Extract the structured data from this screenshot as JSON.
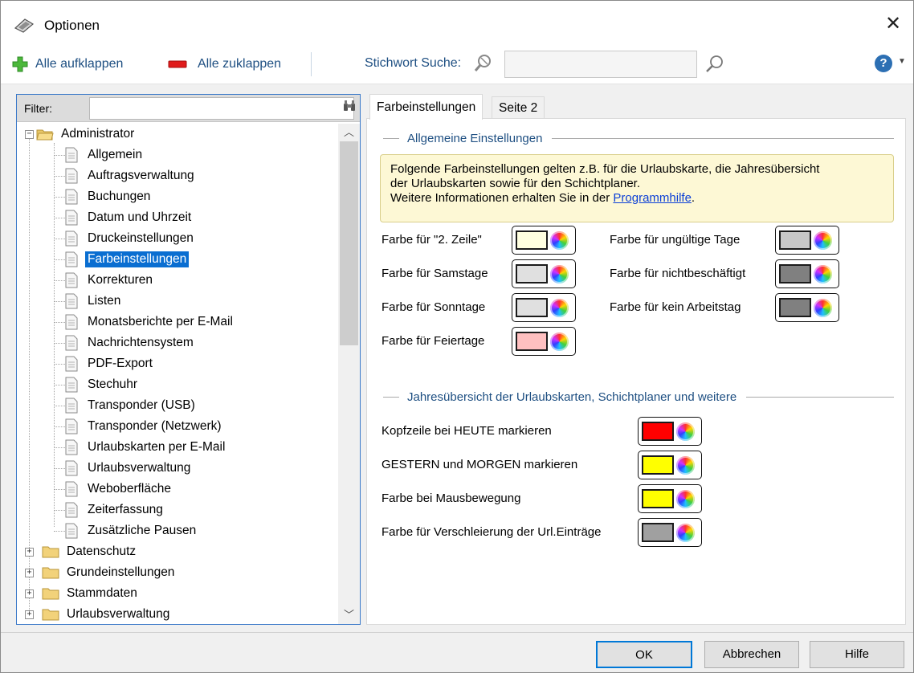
{
  "window": {
    "title": "Optionen",
    "close_glyph": "✕"
  },
  "toolbar": {
    "expand_all": "Alle aufklappen",
    "collapse_all": "Alle zuklappen",
    "search_label": "Stichwort Suche:",
    "search_value": "",
    "help_glyph": "?"
  },
  "filter": {
    "label": "Filter:",
    "value": ""
  },
  "tree": {
    "root": "Administrator",
    "children": [
      "Allgemein",
      "Auftragsverwaltung",
      "Buchungen",
      "Datum und Uhrzeit",
      "Druckeinstellungen",
      "Farbeinstellungen",
      "Korrekturen",
      "Listen",
      "Monatsberichte per E-Mail",
      "Nachrichtensystem",
      "PDF-Export",
      "Stechuhr",
      "Transponder (USB)",
      "Transponder (Netzwerk)",
      "Urlaubskarten per E-Mail",
      "Urlaubsverwaltung",
      "Weboberfläche",
      "Zeiterfassung",
      "Zusätzliche Pausen"
    ],
    "selected_index": 5,
    "other_folders": [
      "Datenschutz",
      "Grundeinstellungen",
      "Stammdaten",
      "Urlaubsverwaltung"
    ]
  },
  "tabs": [
    "Farbeinstellungen",
    "Seite 2"
  ],
  "general": {
    "heading": "Allgemeine Einstellungen",
    "info_line1": "Folgende Farbeinstellungen gelten z.B. für die Urlaubskarte, die Jahresübersicht",
    "info_line2": "der Urlaubskarten sowie für den Schichtplaner.",
    "info_line3": "Weitere Informationen erhalten Sie in der",
    "info_link": "Programmhilfe",
    "info_end": ".",
    "colors_left": [
      {
        "label": "Farbe für \"2. Zeile\"",
        "color": "#ffffe0"
      },
      {
        "label": "Farbe für Samstage",
        "color": "#e0e0e0"
      },
      {
        "label": "Farbe für Sonntage",
        "color": "#e0e0e0"
      },
      {
        "label": "Farbe für Feiertage",
        "color": "#ffc0c0"
      }
    ],
    "colors_right": [
      {
        "label": "Farbe für ungültige Tage",
        "color": "#c8c8c8"
      },
      {
        "label": "Farbe für nichtbeschäftigt",
        "color": "#808080"
      },
      {
        "label": "Farbe für kein Arbeitstag",
        "color": "#808080"
      }
    ]
  },
  "yearly": {
    "heading": "Jahresübersicht der Urlaubskarten, Schichtplaner und weitere",
    "colors": [
      {
        "label": "Kopfzeile bei HEUTE markieren",
        "color": "#ff0000"
      },
      {
        "label": "GESTERN und MORGEN markieren",
        "color": "#ffff00"
      },
      {
        "label": "Farbe bei Mausbewegung",
        "color": "#ffff00"
      },
      {
        "label": "Farbe für Verschleierung der Url.Einträge",
        "color": "#a0a0a0"
      }
    ]
  },
  "buttons": {
    "ok": "OK",
    "cancel": "Abbrechen",
    "help": "Hilfe"
  }
}
